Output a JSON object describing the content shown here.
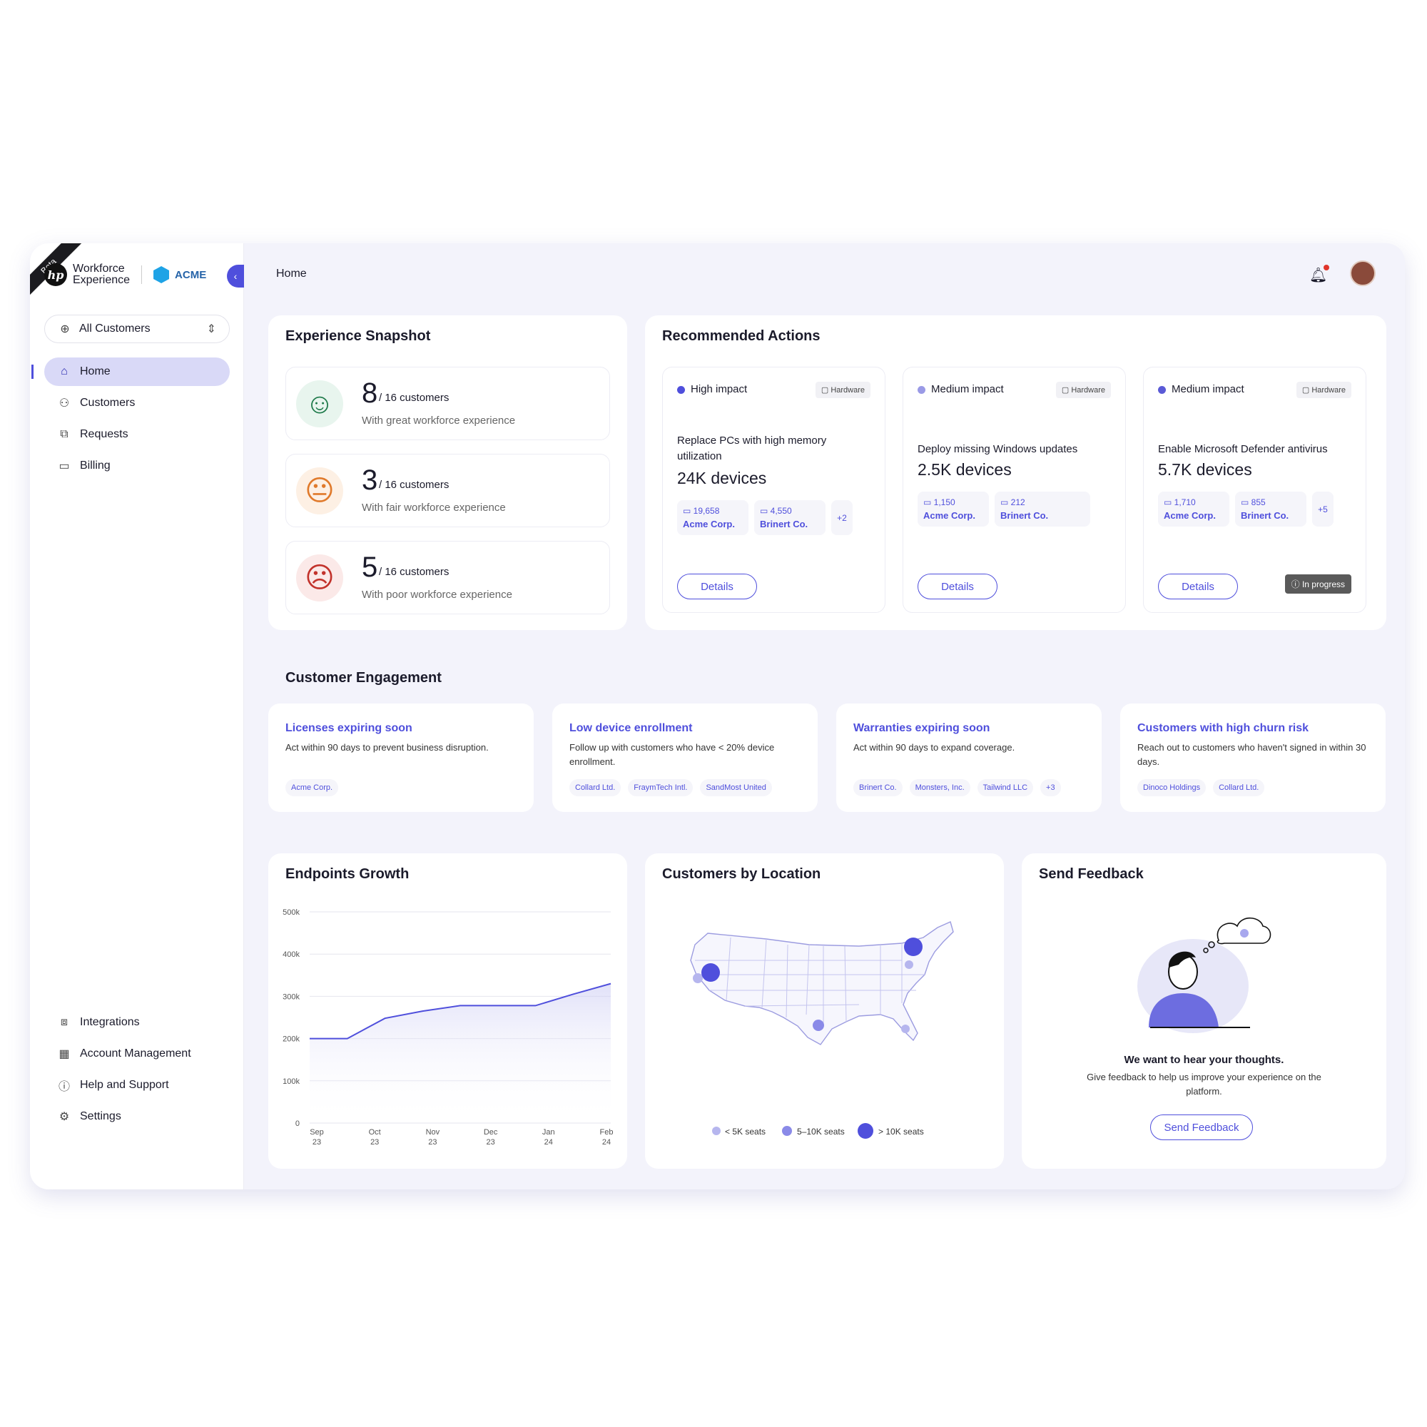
{
  "app": {
    "beta": "Beta",
    "brand_line1": "Workforce",
    "brand_line2": "Experience",
    "partner": "ACME"
  },
  "sidebar": {
    "selector": "All Customers",
    "nav": [
      {
        "label": "Home",
        "icon": "home-icon"
      },
      {
        "label": "Customers",
        "icon": "users-icon"
      },
      {
        "label": "Requests",
        "icon": "requests-icon"
      },
      {
        "label": "Billing",
        "icon": "billing-icon"
      }
    ],
    "bottom": [
      {
        "label": "Integrations",
        "icon": "integrations-icon"
      },
      {
        "label": "Account Management",
        "icon": "building-icon"
      },
      {
        "label": "Help and Support",
        "icon": "help-icon"
      },
      {
        "label": "Settings",
        "icon": "gear-icon"
      }
    ]
  },
  "header": {
    "breadcrumb": "Home"
  },
  "snapshot": {
    "title": "Experience Snapshot",
    "rows": [
      {
        "count": "8",
        "total": "/ 16 customers",
        "desc": "With great workforce experience",
        "face": "😊",
        "color": "#1e7a4a"
      },
      {
        "count": "3",
        "total": "/ 16 customers",
        "desc": "With fair workforce experience",
        "face": "😐",
        "color": "#e07a2b"
      },
      {
        "count": "5",
        "total": "/ 16 customers",
        "desc": "With poor workforce experience",
        "face": "☹",
        "color": "#c2322b"
      }
    ]
  },
  "actions": {
    "title": "Recommended Actions",
    "items": [
      {
        "impact": "High impact",
        "tag": "Hardware",
        "title": "Replace PCs with high memory utilization",
        "count": "24K devices",
        "chips": [
          {
            "n": "19,658",
            "c": "Acme Corp."
          },
          {
            "n": "4,550",
            "c": "Brinert Co."
          }
        ],
        "more": "+2",
        "button": "Details",
        "status": ""
      },
      {
        "impact": "Medium impact",
        "tag": "Hardware",
        "title": "Deploy missing Windows updates",
        "count": "2.5K devices",
        "chips": [
          {
            "n": "1,150",
            "c": "Acme Corp."
          },
          {
            "n": "212",
            "c": "Brinert Co."
          }
        ],
        "more": "",
        "button": "Details",
        "status": ""
      },
      {
        "impact": "Medium impact",
        "tag": "Hardware",
        "title": "Enable Microsoft Defender antivirus",
        "count": "5.7K devices",
        "chips": [
          {
            "n": "1,710",
            "c": "Acme Corp."
          },
          {
            "n": "855",
            "c": "Brinert Co."
          }
        ],
        "more": "+5",
        "button": "Details",
        "status": "In progress"
      }
    ]
  },
  "engagement": {
    "title": "Customer Engagement",
    "items": [
      {
        "title": "Licenses expiring soon",
        "desc": "Act within 90 days to prevent business disruption.",
        "tags": [
          "Acme Corp."
        ]
      },
      {
        "title": "Low device enrollment",
        "desc": "Follow up with customers who have < 20% device enrollment.",
        "tags": [
          "Collard Ltd.",
          "FraymTech Intl.",
          "SandMost United"
        ]
      },
      {
        "title": "Warranties expiring soon",
        "desc": "Act within 90 days to expand coverage.",
        "tags": [
          "Brinert Co.",
          "Monsters, Inc.",
          "Tailwind LLC",
          "+3"
        ]
      },
      {
        "title": "Customers with high churn risk",
        "desc": "Reach out to customers who haven't signed in within 30 days.",
        "tags": [
          "Dinoco Holdings",
          "Collard Ltd."
        ]
      }
    ]
  },
  "chart_data": {
    "type": "area",
    "title": "Endpoints Growth",
    "categories": [
      "Sep 23",
      "",
      "Oct 23",
      "",
      "Nov 23",
      "",
      "Dec 23",
      "",
      "Jan 24",
      "",
      "Feb 24"
    ],
    "x_ticks": [
      [
        "Sep",
        "23"
      ],
      [
        "Oct",
        "23"
      ],
      [
        "Nov",
        "23"
      ],
      [
        "Dec",
        "23"
      ],
      [
        "Jan",
        "24"
      ],
      [
        "Feb",
        "24"
      ]
    ],
    "values": [
      200000,
      200000,
      248000,
      265000,
      278000,
      278000,
      278000,
      305000,
      330000
    ],
    "ylim": [
      0,
      500000
    ],
    "y_ticks": [
      "500k",
      "400k",
      "300k",
      "200k",
      "100k",
      "0"
    ],
    "color": "#4f4fdc"
  },
  "location": {
    "title": "Customers by Location",
    "legend": [
      "< 5K seats",
      "5–10K seats",
      "> 10K seats"
    ],
    "color": "#4f4fdc"
  },
  "feedback": {
    "title": "Send Feedback",
    "heading": "We want to hear your thoughts.",
    "body": "Give feedback to help us improve your experience on the platform.",
    "button": "Send Feedback"
  }
}
